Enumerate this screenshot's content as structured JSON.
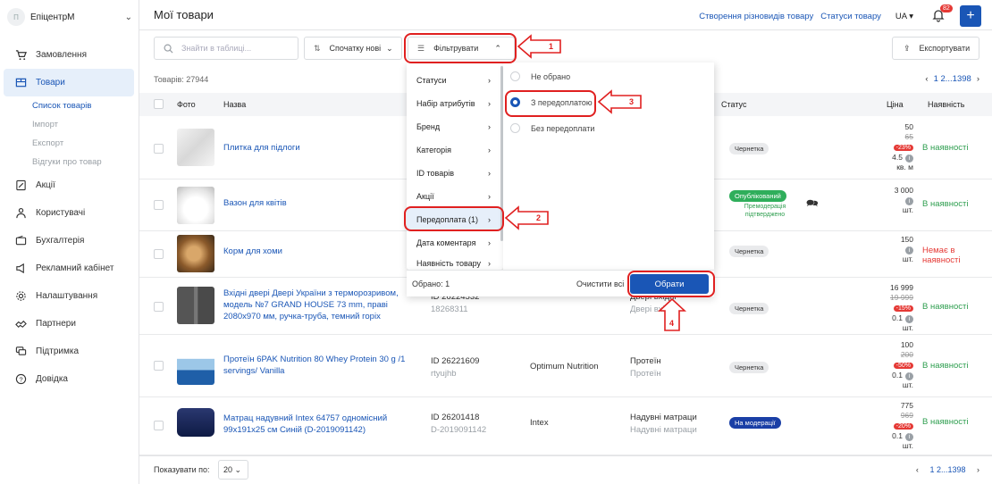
{
  "sidebar": {
    "org": {
      "initials": "П",
      "name": "ЕпіцентрМ"
    },
    "items": [
      {
        "label": "Замовлення",
        "icon": "cart-icon"
      },
      {
        "label": "Товари",
        "icon": "box-icon"
      },
      {
        "label": "Акції",
        "icon": "percent-icon"
      },
      {
        "label": "Користувачі",
        "icon": "users-icon"
      },
      {
        "label": "Бухгалтерія",
        "icon": "wallet-icon"
      },
      {
        "label": "Рекламний кабінет",
        "icon": "megaphone-icon"
      },
      {
        "label": "Налаштування",
        "icon": "gear-icon"
      },
      {
        "label": "Партнери",
        "icon": "handshake-icon"
      },
      {
        "label": "Підтримка",
        "icon": "chat-icon"
      },
      {
        "label": "Довідка",
        "icon": "help-icon"
      }
    ],
    "subitems": [
      "Список товарів",
      "Імпорт",
      "Експорт",
      "Відгуки про товар"
    ]
  },
  "header": {
    "title": "Мої товари",
    "link1": "Створення різновидів товару",
    "link2": "Статуси товару",
    "lang": "UA",
    "notif_count": "82"
  },
  "toolbar": {
    "search_placeholder": "Знайти в таблиці...",
    "sort_label": "Спочатку нові",
    "filter_label": "Фільтрувати",
    "export_label": "Експортувати"
  },
  "table": {
    "count_label": "Товарів: 27944",
    "pager": "1  2...1398",
    "columns": {
      "photo": "Фото",
      "name": "Назва",
      "status": "Статус",
      "price": "Ціна",
      "avail": "Наявність"
    },
    "rows": [
      {
        "name": "Плитка для підлоги",
        "price": "50",
        "old": "65",
        "disc": "-23%",
        "unit": "4.5",
        "unit2": "кв. м",
        "status": "Чернетка",
        "avail": "В наявності"
      },
      {
        "name": "Вазон для квітів",
        "price": "3 000",
        "unit2": "шт.",
        "status": "Опублікований",
        "status_note": "Премодерація підтверджено",
        "avail": "В наявності"
      },
      {
        "name": "Корм для хоми",
        "price": "150",
        "unit2": "шт.",
        "status": "Чернетка",
        "avail": "Немає в наявності"
      },
      {
        "name": "Вхідні двері Двері України з терморозривом, модель №7 GRAND HOUSE 73 mm, праві 2080x970 мм, ручка-труба, темний горіх",
        "id": "ID 26224532",
        "sku": "18268311",
        "cat": "Двері вхідні",
        "cat2": "Двері вхідні",
        "price": "16 999",
        "old": "19 999",
        "disc": "-15%",
        "unit": "0.1",
        "unit2": "шт.",
        "status": "Чернетка",
        "avail": "В наявності"
      },
      {
        "name": "Протеїн 6PAK Nutrition 80 Whey Protein 30 g /1 servings/ Vanilla",
        "id": "ID 26221609",
        "sku": "rtyujhb",
        "brand": "Optimum Nutrition",
        "cat": "Протеїн",
        "cat2": "Протеїн",
        "price": "100",
        "old": "200",
        "disc": "-50%",
        "unit": "0.1",
        "unit2": "шт.",
        "status": "Чернетка",
        "avail": "В наявності"
      },
      {
        "name": "Матрац надувний Intex 64757 одномісний 99x191x25 см Синій (D-2019091142)",
        "id": "ID 26201418",
        "sku": "D-2019091142",
        "brand": "Intex",
        "cat": "Надувні матраци",
        "cat2": "Надувні матраци",
        "price": "775",
        "old": "969",
        "disc": "-20%",
        "unit": "0.1",
        "unit2": "шт.",
        "status": "На модерації",
        "avail": "В наявності"
      }
    ]
  },
  "filter_menu": {
    "items": [
      "Статуси",
      "Набір атрибутів",
      "Бренд",
      "Категорія",
      "ID товарів",
      "Акції",
      "Передоплата (1)",
      "Дата коментаря",
      "Наявність товару"
    ],
    "options": [
      "Не обрано",
      "З передоплатою",
      "Без передоплати"
    ],
    "selected_label": "Обрано: 1",
    "clear_label": "Очистити всі",
    "select_label": "Обрати"
  },
  "footer": {
    "show_label": "Показувати по:",
    "per_page": "20",
    "pager": "1  2...1398"
  },
  "annotations": [
    "1",
    "2",
    "3",
    "4"
  ]
}
